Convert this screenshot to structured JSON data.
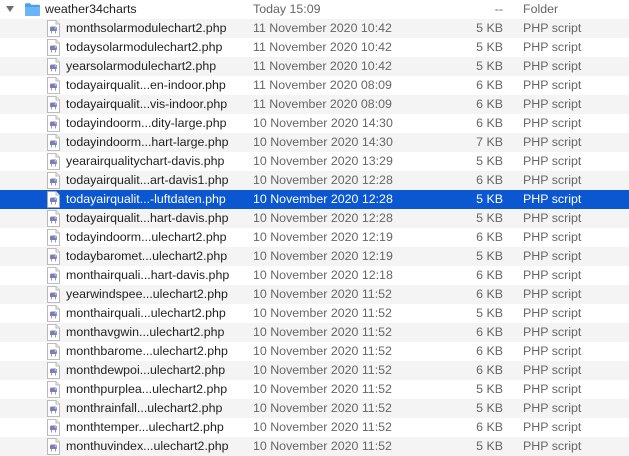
{
  "folder": {
    "name": "weather34charts",
    "date": "Today 15:09",
    "size": "--",
    "kind": "Folder",
    "expanded": true,
    "icon": "folder-icon",
    "color": "#4a9ff0"
  },
  "selection_color": "#0a57d1",
  "files": [
    {
      "name": "monthsolarmodulechart2.php",
      "date": "11 November 2020 10:42",
      "size": "5 KB",
      "kind": "PHP script",
      "selected": false
    },
    {
      "name": "todaysolarmodulechart2.php",
      "date": "11 November 2020 10:42",
      "size": "5 KB",
      "kind": "PHP script",
      "selected": false
    },
    {
      "name": "yearsolarmodulechart2.php",
      "date": "11 November 2020 10:42",
      "size": "5 KB",
      "kind": "PHP script",
      "selected": false
    },
    {
      "name": "todayairqualit...en-indoor.php",
      "date": "11 November 2020 08:09",
      "size": "6 KB",
      "kind": "PHP script",
      "selected": false
    },
    {
      "name": "todayairqualit...vis-indoor.php",
      "date": "11 November 2020 08:09",
      "size": "6 KB",
      "kind": "PHP script",
      "selected": false
    },
    {
      "name": "todayindoorm...dity-large.php",
      "date": "10 November 2020 14:30",
      "size": "6 KB",
      "kind": "PHP script",
      "selected": false
    },
    {
      "name": "todayindoorm...hart-large.php",
      "date": "10 November 2020 14:30",
      "size": "7 KB",
      "kind": "PHP script",
      "selected": false
    },
    {
      "name": "yearairqualitychart-davis.php",
      "date": "10 November 2020 13:29",
      "size": "5 KB",
      "kind": "PHP script",
      "selected": false
    },
    {
      "name": "todayairqualit...art-davis1.php",
      "date": "10 November 2020 12:28",
      "size": "6 KB",
      "kind": "PHP script",
      "selected": false
    },
    {
      "name": "todayairqualit...-luftdaten.php",
      "date": "10 November 2020 12:28",
      "size": "5 KB",
      "kind": "PHP script",
      "selected": true
    },
    {
      "name": "todayairqualit...hart-davis.php",
      "date": "10 November 2020 12:28",
      "size": "5 KB",
      "kind": "PHP script",
      "selected": false
    },
    {
      "name": "todayindoorm...ulechart2.php",
      "date": "10 November 2020 12:19",
      "size": "6 KB",
      "kind": "PHP script",
      "selected": false
    },
    {
      "name": "todaybaromet...ulechart2.php",
      "date": "10 November 2020 12:19",
      "size": "5 KB",
      "kind": "PHP script",
      "selected": false
    },
    {
      "name": "monthairquali...hart-davis.php",
      "date": "10 November 2020 12:18",
      "size": "6 KB",
      "kind": "PHP script",
      "selected": false
    },
    {
      "name": "yearwindspee...ulechart2.php",
      "date": "10 November 2020 11:52",
      "size": "6 KB",
      "kind": "PHP script",
      "selected": false
    },
    {
      "name": "monthairquali...ulechart2.php",
      "date": "10 November 2020 11:52",
      "size": "5 KB",
      "kind": "PHP script",
      "selected": false
    },
    {
      "name": "monthavgwin...ulechart2.php",
      "date": "10 November 2020 11:52",
      "size": "6 KB",
      "kind": "PHP script",
      "selected": false
    },
    {
      "name": "monthbarome...ulechart2.php",
      "date": "10 November 2020 11:52",
      "size": "6 KB",
      "kind": "PHP script",
      "selected": false
    },
    {
      "name": "monthdewpoi...ulechart2.php",
      "date": "10 November 2020 11:52",
      "size": "6 KB",
      "kind": "PHP script",
      "selected": false
    },
    {
      "name": "monthpurplea...ulechart2.php",
      "date": "10 November 2020 11:52",
      "size": "5 KB",
      "kind": "PHP script",
      "selected": false
    },
    {
      "name": "monthrainfall...ulechart2.php",
      "date": "10 November 2020 11:52",
      "size": "5 KB",
      "kind": "PHP script",
      "selected": false
    },
    {
      "name": "monthtemper...ulechart2.php",
      "date": "10 November 2020 11:52",
      "size": "6 KB",
      "kind": "PHP script",
      "selected": false
    },
    {
      "name": "monthuvindex...ulechart2.php",
      "date": "10 November 2020 11:52",
      "size": "5 KB",
      "kind": "PHP script",
      "selected": false
    }
  ]
}
